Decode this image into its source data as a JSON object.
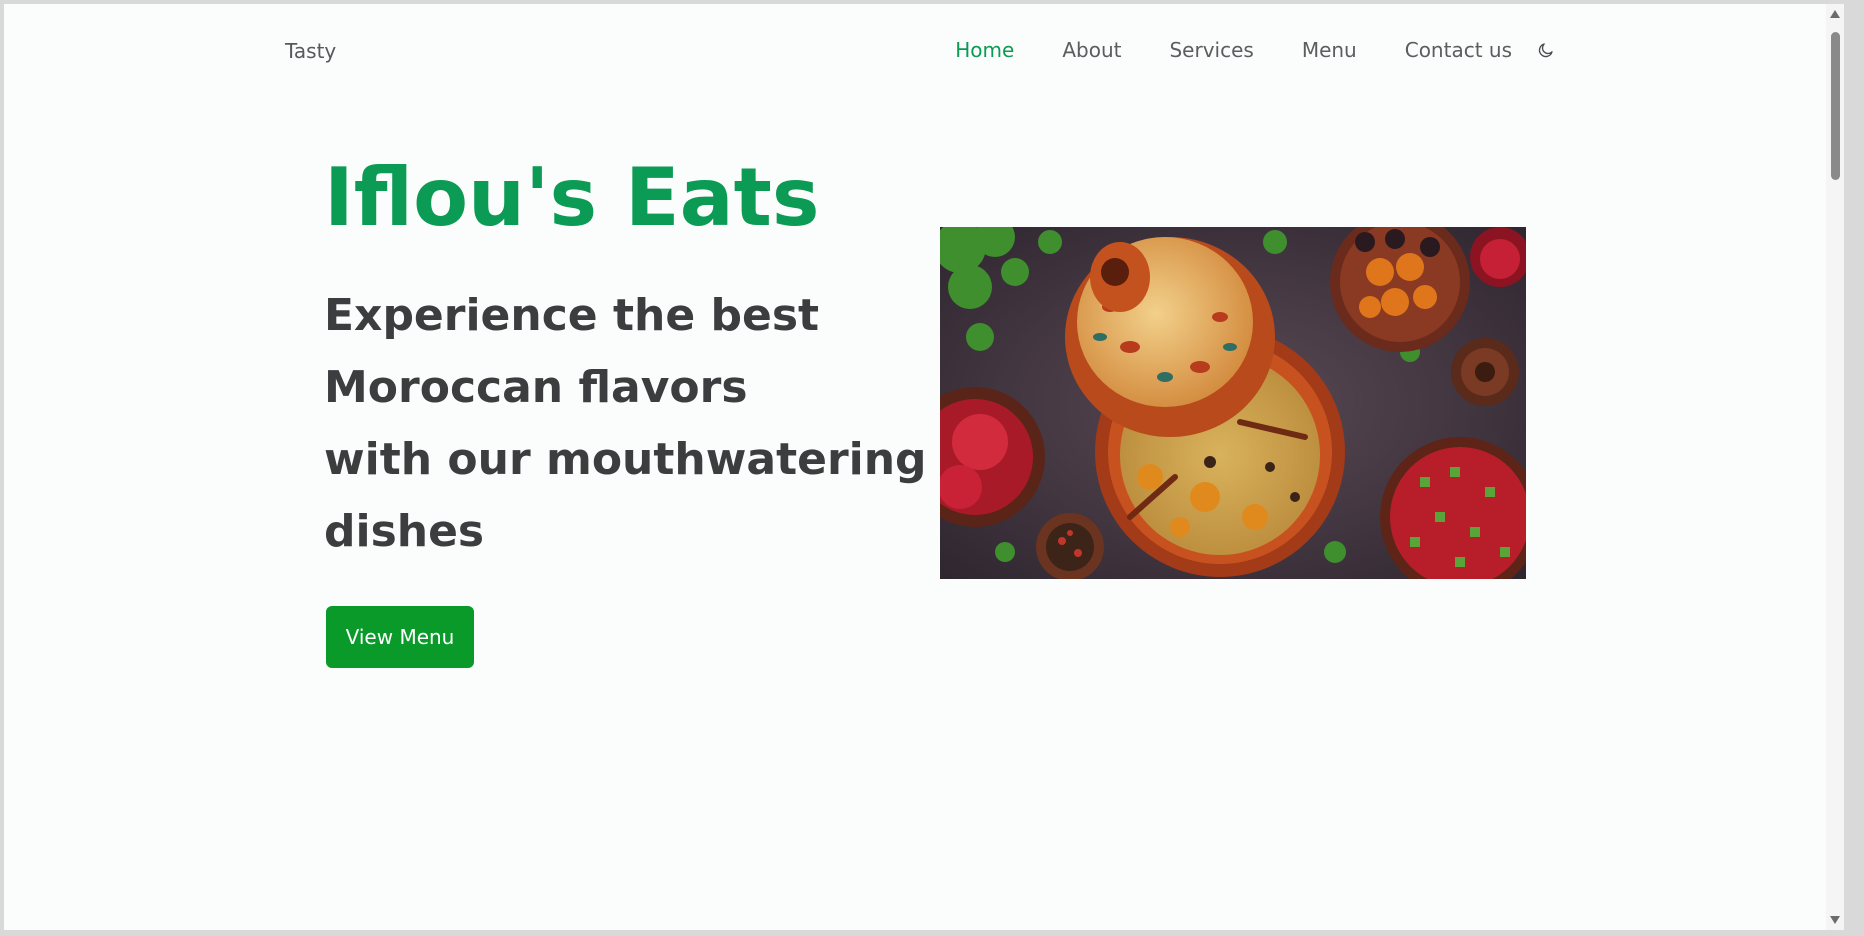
{
  "header": {
    "brand": "Tasty",
    "nav": [
      {
        "label": "Home",
        "active": true
      },
      {
        "label": "About",
        "active": false
      },
      {
        "label": "Services",
        "active": false
      },
      {
        "label": "Menu",
        "active": false
      },
      {
        "label": "Contact us",
        "active": false
      }
    ],
    "theme_toggle_icon": "moon-icon"
  },
  "hero": {
    "title": "Iflou's Eats",
    "subtitle_lines": [
      "Experience the best",
      "Moroccan flavors",
      "with our mouthwatering",
      "dishes"
    ],
    "cta_label": "View Menu"
  },
  "colors": {
    "accent": "#0b9b54",
    "button": "#0a9a2a",
    "text": "#3b3d3f",
    "background": "#fbfcfc"
  }
}
